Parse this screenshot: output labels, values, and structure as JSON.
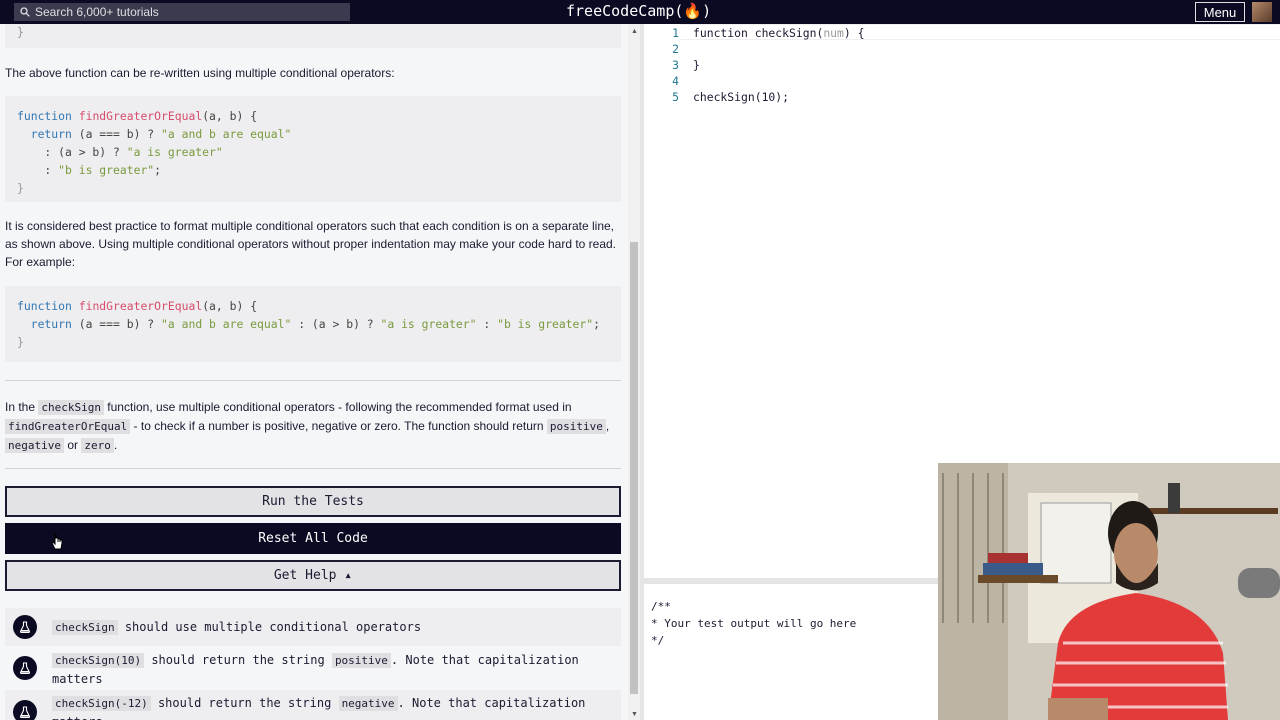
{
  "nav": {
    "search_placeholder": "Search 6,000+ tutorials",
    "brand": "freeCodeCamp(🔥)",
    "menu_label": "Menu"
  },
  "lesson": {
    "top_brace": "}",
    "para1": "The above function can be re-written using multiple conditional operators:",
    "code1": {
      "l1_kw": "function",
      "l1_fn": "findGreaterOrEqual",
      "l1_args": "(a, b) {",
      "l2_kw": "return",
      "l2_rest_a": " (a === b) ? ",
      "l2_str": "\"a and b are equal\"",
      "l3_rest": "    : (a > b) ? ",
      "l3_str": "\"a is greater\"",
      "l4_rest": "    : ",
      "l4_str": "\"b is greater\"",
      "l4_end": ";",
      "l5": "}"
    },
    "para2": "It is considered best practice to format multiple conditional operators such that each condition is on a separate line, as shown above. Using multiple conditional operators without proper indentation may make your code hard to read. For example:",
    "code2": {
      "l1_kw": "function",
      "l1_fn": "findGreaterOrEqual",
      "l1_args": "(a, b) {",
      "l2_kw": "return",
      "l2_rest_a": " (a === b) ? ",
      "l2_str1": "\"a and b are equal\"",
      "l2_mid": " : (a > b) ? ",
      "l2_str2": "\"a is greater\"",
      "l2_mid2": " : ",
      "l2_str3": "\"b is greater\"",
      "l2_end": ";",
      "l3": "}"
    },
    "instr": {
      "t1": "In the ",
      "c1": "checkSign",
      "t2": " function, use multiple conditional operators - following the recommended format used in ",
      "c2": "findGreaterOrEqual",
      "t3": " - to check if a number is positive, negative or zero. The function should return ",
      "c3": "positive",
      "t4": ", ",
      "c4": "negative",
      "t5": " or ",
      "c5": "zero",
      "t6": "."
    }
  },
  "buttons": {
    "run": "Run the Tests",
    "reset": "Reset All Code",
    "help": "Get Help ▴"
  },
  "tests": [
    {
      "code": "checkSign",
      "text": " should use multiple conditional operators"
    },
    {
      "code": "checkSign(10)",
      "text": " should return the string ",
      "code2": "positive",
      "text2": ". Note that capitalization matters"
    },
    {
      "code": "checkSign(-12)",
      "text": " should return the string ",
      "code2": "negative",
      "text2": ". Note that capitalization matters"
    }
  ],
  "editor": {
    "line_numbers": [
      "1",
      "2",
      "3",
      "4",
      "5"
    ],
    "l1_a": "function checkSign(",
    "l1_b": "num",
    "l1_c": ") {",
    "l3": "}",
    "l5": "checkSign(10);"
  },
  "output": {
    "l1": "/**",
    "l2": "* Your test output will go here",
    "l3": "*/"
  }
}
